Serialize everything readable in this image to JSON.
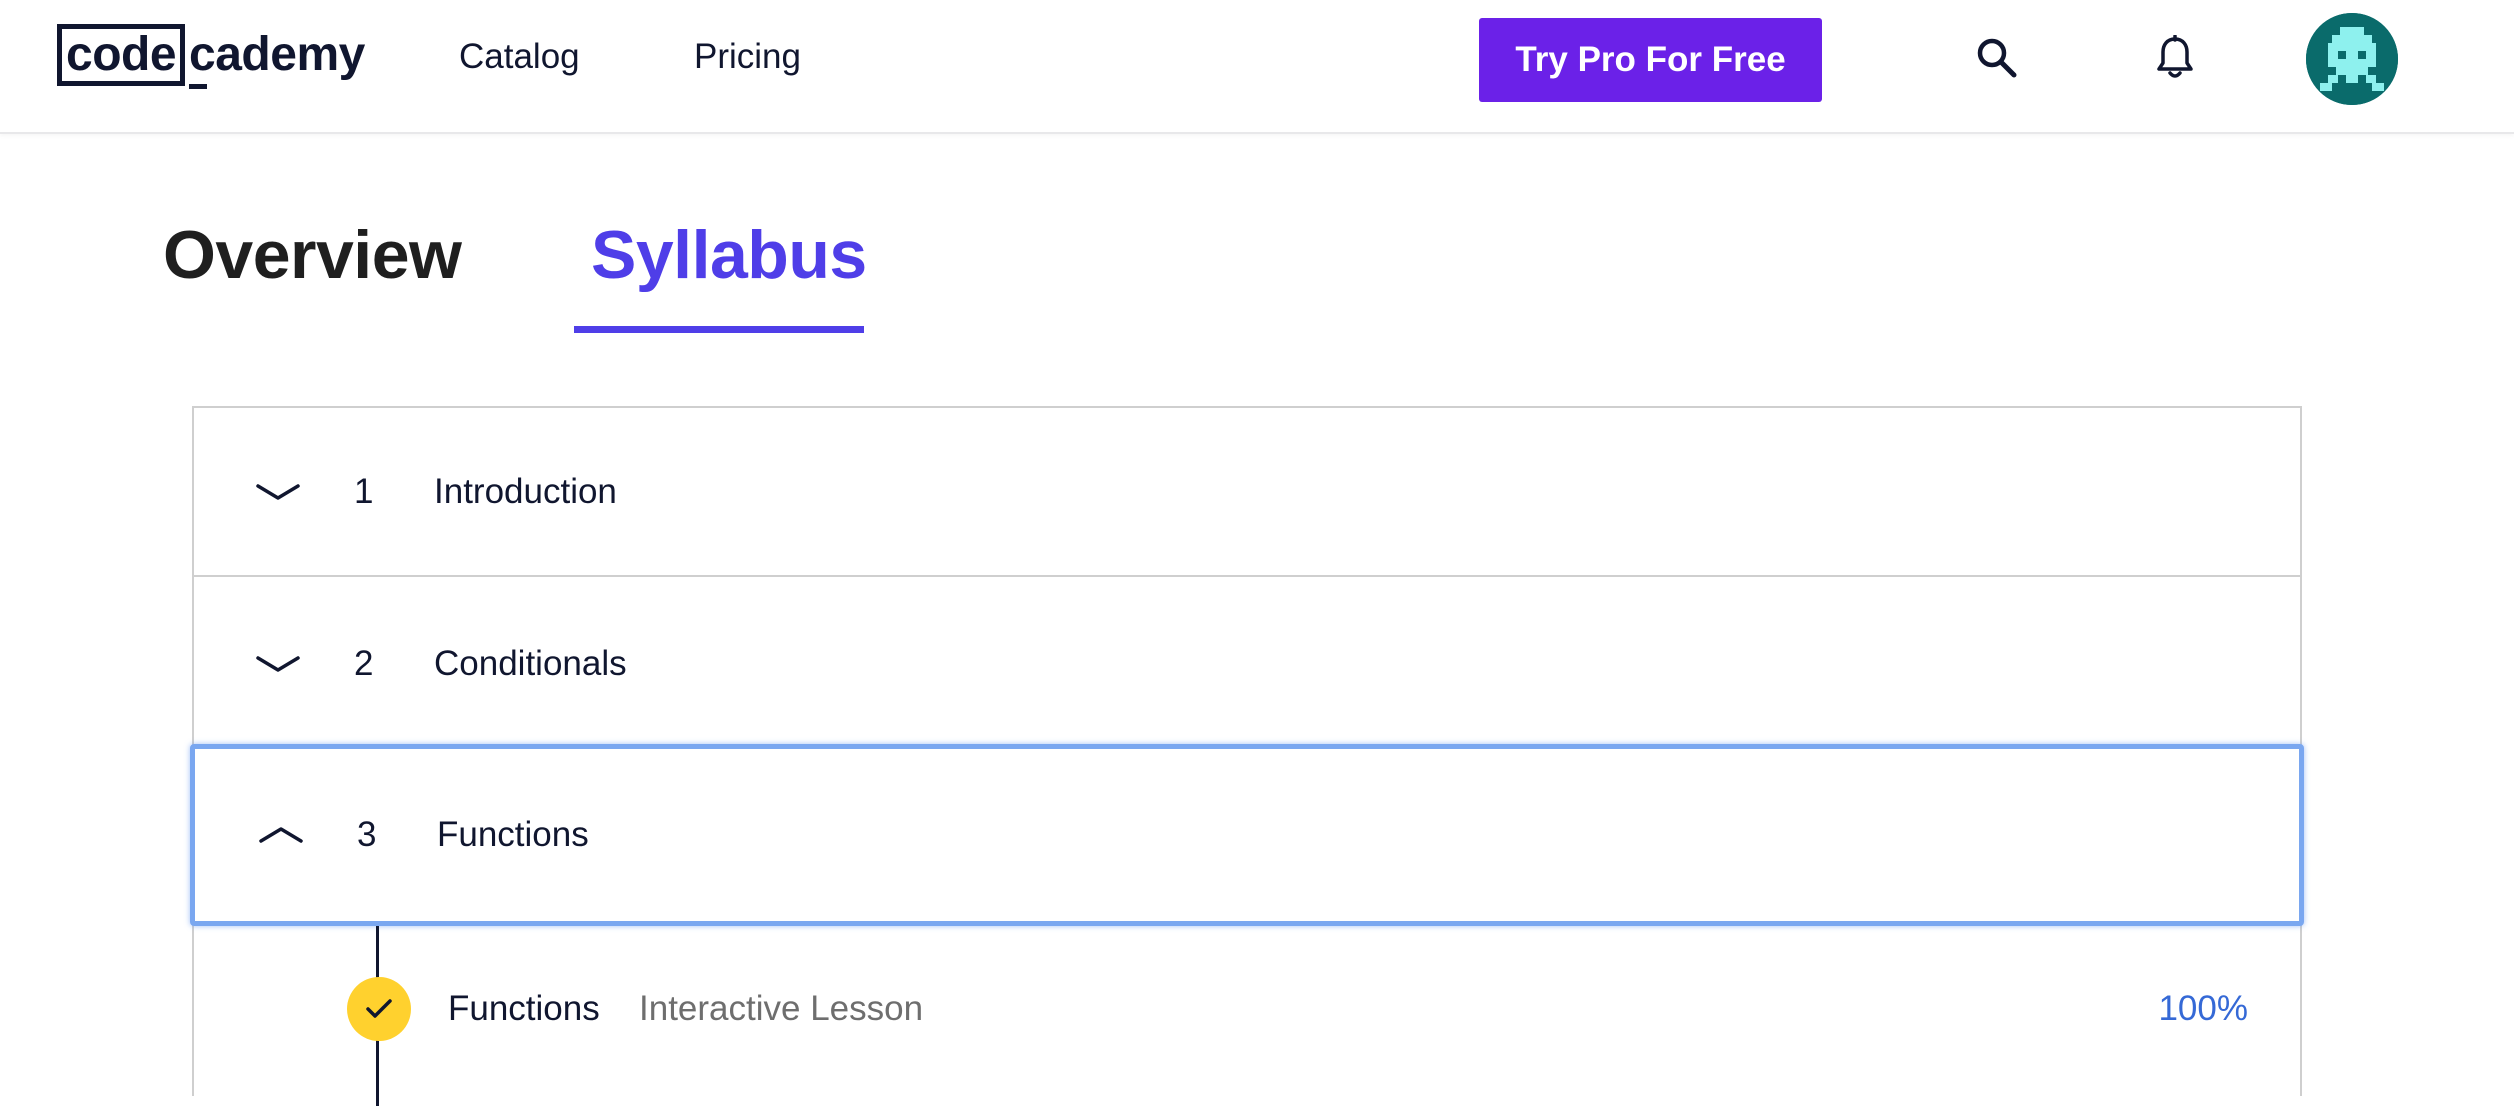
{
  "header": {
    "logo_part1": "code",
    "logo_part2": "cademy",
    "nav": {
      "catalog": "Catalog",
      "pricing": "Pricing"
    },
    "pro_button_label": "Try Pro For Free",
    "icons": {
      "search": "search-icon",
      "notifications": "bell-icon",
      "avatar": "pixel-robot-avatar"
    }
  },
  "tabs": [
    {
      "label": "Overview",
      "active": false
    },
    {
      "label": "Syllabus",
      "active": true
    }
  ],
  "syllabus": {
    "modules": [
      {
        "number": "1",
        "title": "Introduction",
        "expanded": false
      },
      {
        "number": "2",
        "title": "Conditionals",
        "expanded": false
      },
      {
        "number": "3",
        "title": "Functions",
        "expanded": true
      }
    ],
    "lessons": [
      {
        "title": "Functions",
        "type": "Interactive Lesson",
        "progress": "100%",
        "completed": true
      }
    ]
  },
  "colors": {
    "brand_purple": "#6b21e8",
    "active_tab": "#4f3ee8",
    "focus_outline": "#7aa7f0",
    "progress_blue": "#3569d6",
    "check_yellow": "#ffd12e"
  }
}
